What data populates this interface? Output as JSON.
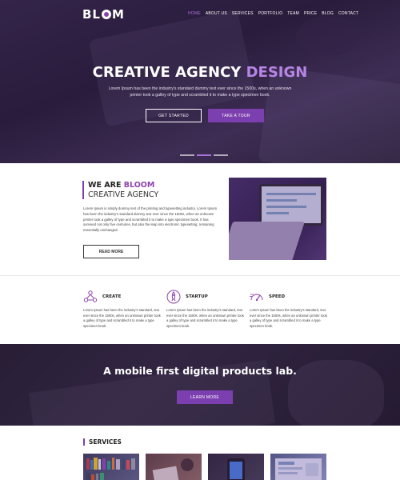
{
  "brand": {
    "logo_left": "BL",
    "logo_right": "M",
    "accent_color": "#7b3fb0"
  },
  "nav": {
    "items": [
      "HOME",
      "ABOUT US",
      "SERVICES",
      "PORTFOLIO",
      "TEAM",
      "PRICE",
      "BLOG",
      "CONTACT"
    ],
    "active_index": 0
  },
  "hero": {
    "title_main": "CREATIVE AGENCY",
    "title_accent": "DESIGN",
    "subtitle_line1": "Lorem Ipsum has been the industry's standard dummy text ever since the 1500s, when an unknown",
    "subtitle_line2": "printer took a galley of type and scrambled it to make a type specimen book.",
    "btn_get_started": "GET STARTED",
    "btn_take_tour": "TAKE A TOUR",
    "slider_active": 2
  },
  "about": {
    "heading_prefix": "WE ARE",
    "heading_accent": "BLOOM",
    "heading_line2": "CREATIVE AGENCY",
    "text": "Lorem Ipsum is simply dummy text of the printing and typesetting industry. Lorem Ipsum has been the industry's standard dummy text ever since the 1500s, when an unknown printer took a galley of type and scrambled it to make a type specimen book. It has survived not only five centuries, but also the leap into electronic typesetting, remaining essentially unchanged.",
    "btn_read_more": "READ MORE"
  },
  "features": [
    {
      "icon": "network-icon",
      "title": "CREATE",
      "desc": "Lorem Ipsum has been the industry's standard, text ever since the 1500s, when an unknown printer took a galley of type and scrambled it to make a type specimen book."
    },
    {
      "icon": "rocket-icon",
      "title": "STARTUP",
      "desc": "Lorem Ipsum has been the industry's standard, text ever since the 1500s, when an unknown printer took a galley of type and scrambled it to make a type specimen book."
    },
    {
      "icon": "speed-icon",
      "title": "SPEED",
      "desc": "Lorem Ipsum has been the industry's standard, text ever since the 1500s, when an unknown printer took a galley of type and scrambled it to make a type specimen book."
    }
  ],
  "cta": {
    "title": "A mobile first digital products lab.",
    "btn_learn_more": "LEARN MORE"
  },
  "services": {
    "heading": "SERVICES",
    "thumbs": [
      {
        "name": "bookshelf",
        "color": "#3b4a5e"
      },
      {
        "name": "desk",
        "color": "#6b4a3a"
      },
      {
        "name": "phone",
        "color": "#2d2d33"
      },
      {
        "name": "dashboard",
        "color": "#5a6d8a"
      }
    ]
  }
}
